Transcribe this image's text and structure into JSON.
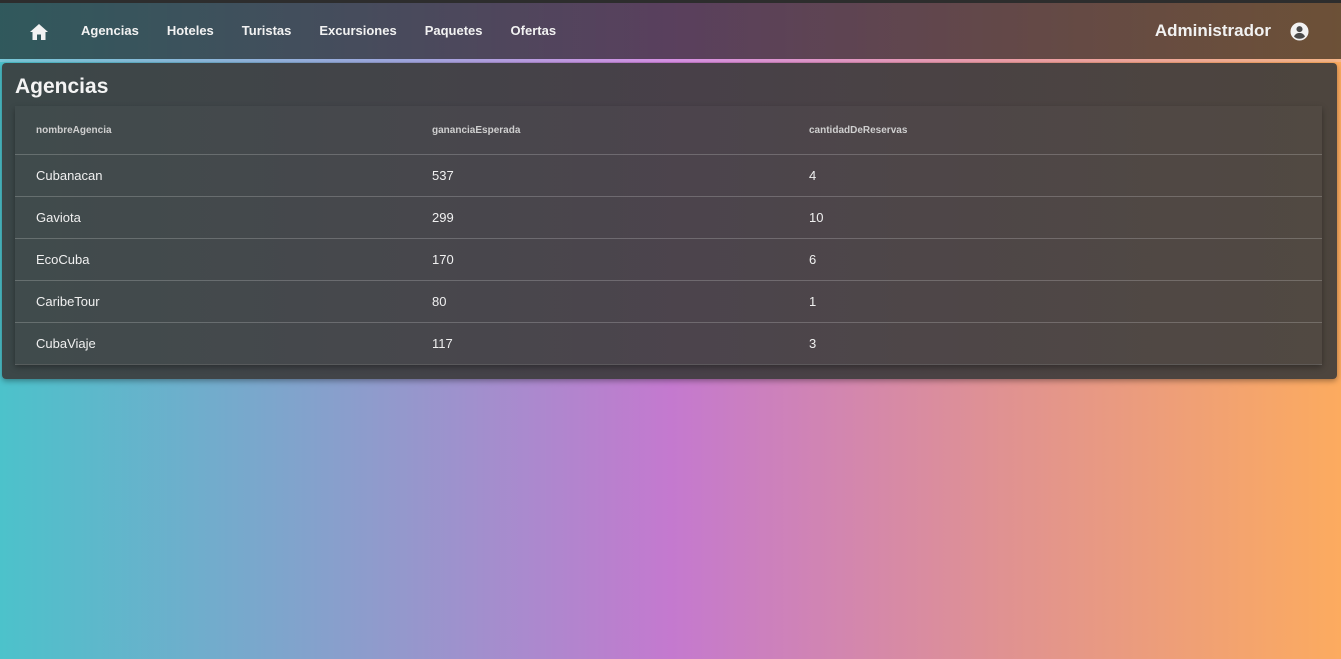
{
  "navbar": {
    "home_icon": "home-icon",
    "links": [
      "Agencias",
      "Hoteles",
      "Turistas",
      "Excursiones",
      "Paquetes",
      "Ofertas"
    ],
    "user_label": "Administrador",
    "user_icon": "account-circle-icon"
  },
  "page": {
    "title": "Agencias"
  },
  "table": {
    "columns": [
      "nombreAgencia",
      "gananciaEsperada",
      "cantidadDeReservas"
    ],
    "rows": [
      [
        "Cubanacan",
        "537",
        "4"
      ],
      [
        "Gaviota",
        "299",
        "10"
      ],
      [
        "EcoCuba",
        "170",
        "6"
      ],
      [
        "CaribeTour",
        "80",
        "1"
      ],
      [
        "CubaViaje",
        "117",
        "3"
      ]
    ]
  },
  "colors": {
    "gradient": [
      "#4cc2cb",
      "#8f9bcc",
      "#c479cf",
      "#e09291",
      "#fcab5f"
    ],
    "navbar_overlay": "#222222",
    "panel_overlay": "#3a3a3a",
    "text": "#f0f0f0"
  }
}
